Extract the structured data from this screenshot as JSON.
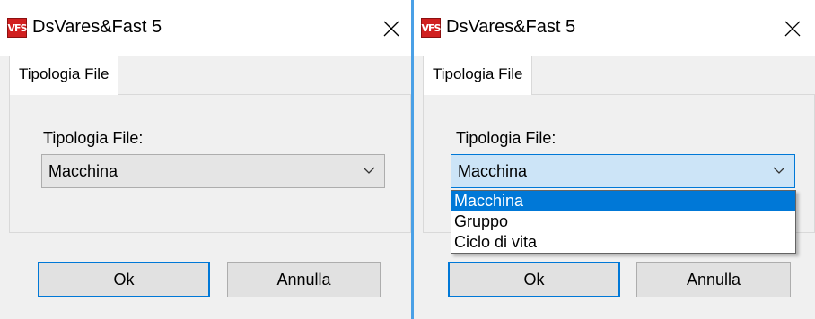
{
  "colors": {
    "accent": "#0078d7",
    "app_icon_bg": "#d11f1f",
    "divider": "#4aa0e6"
  },
  "left_window": {
    "app_icon_text": "VFS",
    "title": "DsVares&Fast 5",
    "close_glyph": "✕",
    "tab_label": "Tipologia File",
    "field_label": "Tipologia File:",
    "combo_value": "Macchina",
    "combo_arrow": "⌵",
    "ok_label": "Ok",
    "cancel_label": "Annulla"
  },
  "right_window": {
    "app_icon_text": "VFS",
    "title": "DsVares&Fast 5",
    "close_glyph": "✕",
    "tab_label": "Tipologia File",
    "field_label": "Tipologia File:",
    "combo_value": "Macchina",
    "combo_arrow": "⌵",
    "dropdown_options": [
      "Macchina",
      "Gruppo",
      "Ciclo di vita"
    ],
    "selected_option": "Macchina",
    "ok_label": "Ok",
    "cancel_label": "Annulla"
  }
}
